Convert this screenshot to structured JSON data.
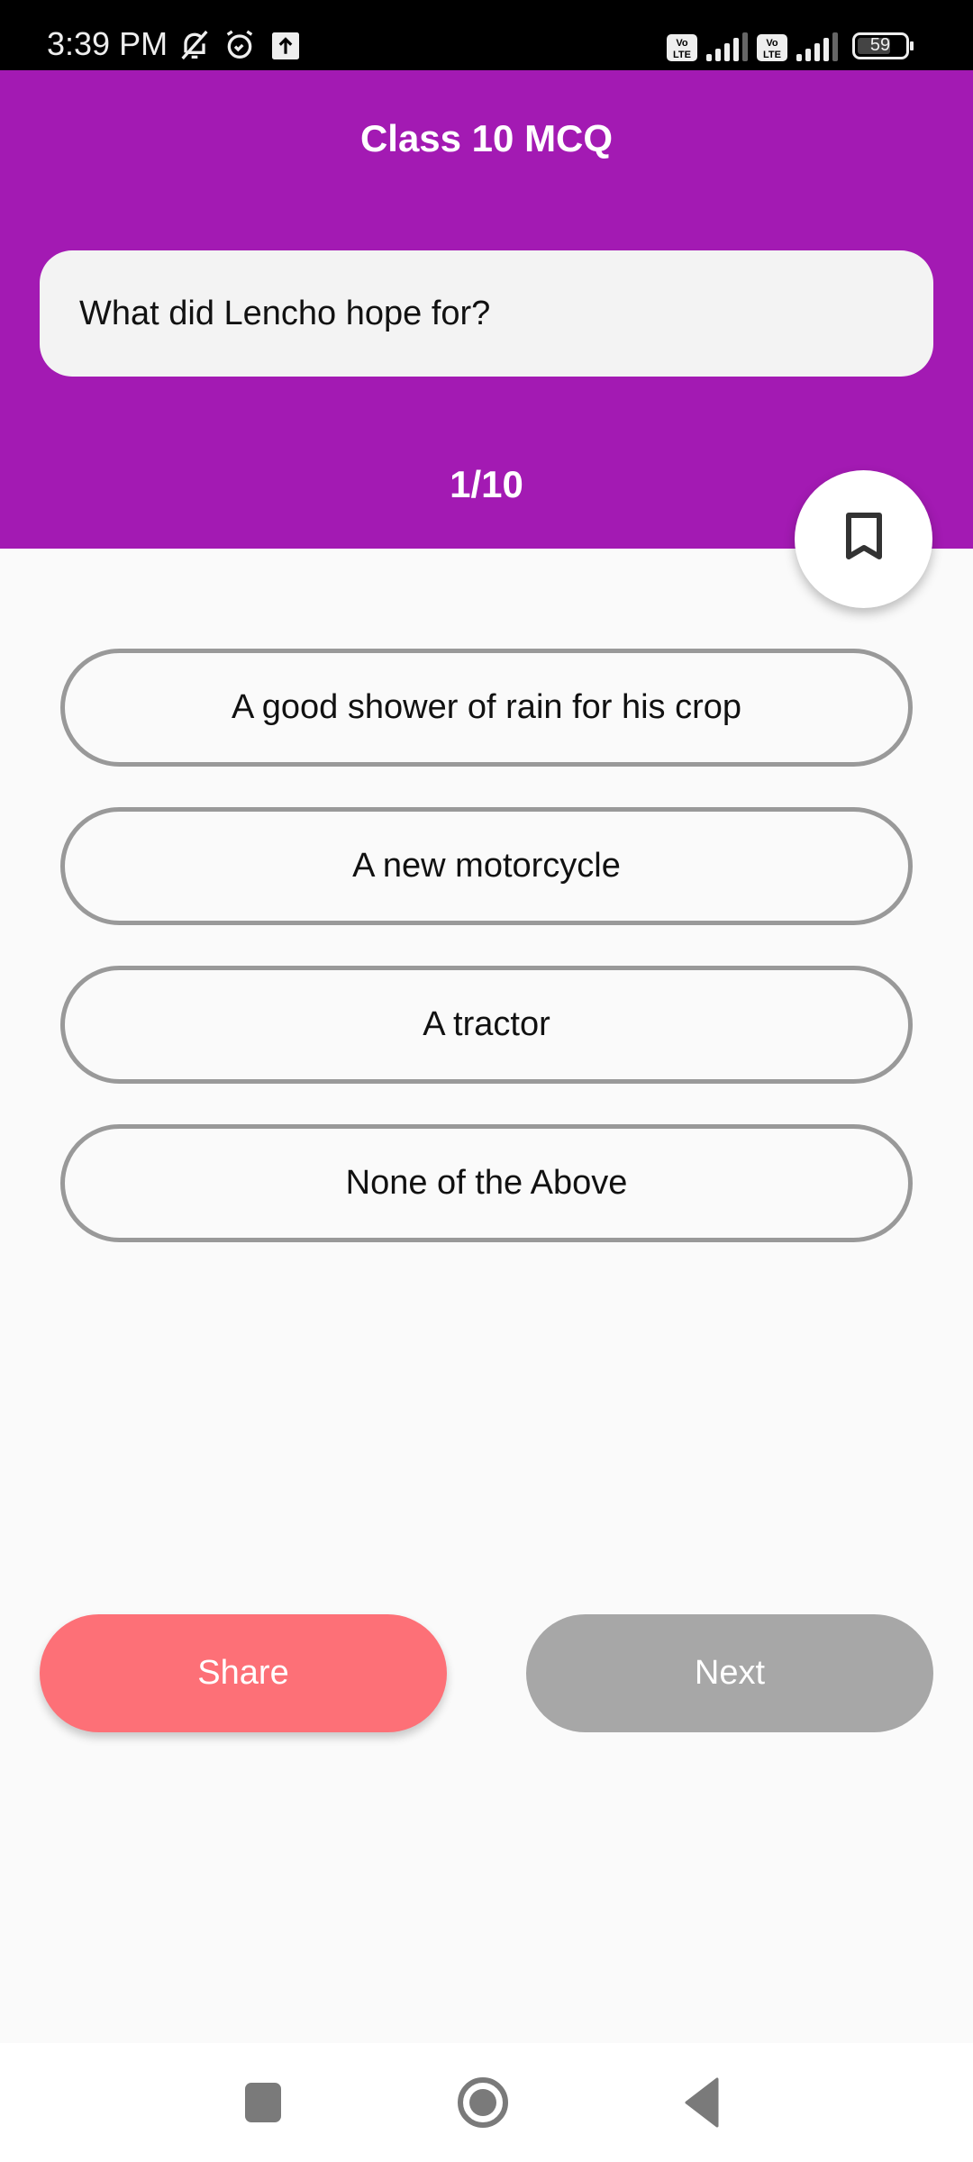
{
  "status_bar": {
    "time": "3:39 PM",
    "icons": [
      "bell-off-icon",
      "alarm-icon",
      "upload-icon",
      "volte-icon",
      "signal-icon",
      "volte-icon",
      "signal-icon"
    ],
    "battery": "59"
  },
  "header": {
    "title": "Class 10 MCQ"
  },
  "question": {
    "text": "What did Lencho hope for?"
  },
  "progress": {
    "label": "1/10",
    "current": 1,
    "total": 10
  },
  "bookmark": {
    "icon": "bookmark-icon"
  },
  "options": [
    {
      "label": "A good shower of rain for his crop"
    },
    {
      "label": "A new motorcycle"
    },
    {
      "label": "A tractor"
    },
    {
      "label": "None of the Above"
    }
  ],
  "actions": {
    "share_label": "Share",
    "next_label": "Next",
    "share_color": "#fd7077",
    "next_color": "#a7a7a7"
  },
  "colors": {
    "primary": "#a31ab3",
    "background": "#fafafa"
  },
  "nav": {
    "buttons": [
      "recents-icon",
      "home-icon",
      "back-icon"
    ]
  }
}
